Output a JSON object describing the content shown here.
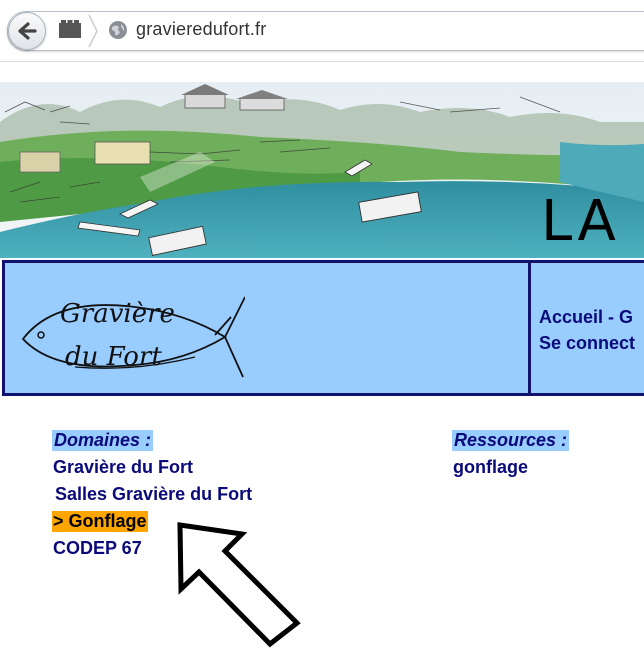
{
  "browser": {
    "url": "gravieredufort.fr",
    "icons": {
      "back": "back-arrow-icon",
      "app": "app-grid-icon",
      "site": "globe-icon"
    }
  },
  "banner": {
    "big_text": "LA"
  },
  "header": {
    "logo_line1": "Gravière",
    "logo_line2": "du Fort",
    "nav_line1": "Accueil - G",
    "nav_line2": "Se connect"
  },
  "domains": {
    "title": "Domaines :",
    "items": [
      {
        "label": "Gravière du Fort"
      },
      {
        "label": "Salles Gravière du Fort"
      },
      {
        "label": "> Gonflage",
        "active": true
      },
      {
        "label": "CODEP 67"
      }
    ]
  },
  "resources": {
    "title": "Ressources :",
    "items": [
      {
        "label": "gonflage"
      }
    ]
  },
  "colors": {
    "nav_blue": "#0a0a7a",
    "header_bg": "#99ccff",
    "border": "#12126e",
    "active_bg": "#ffa500"
  }
}
